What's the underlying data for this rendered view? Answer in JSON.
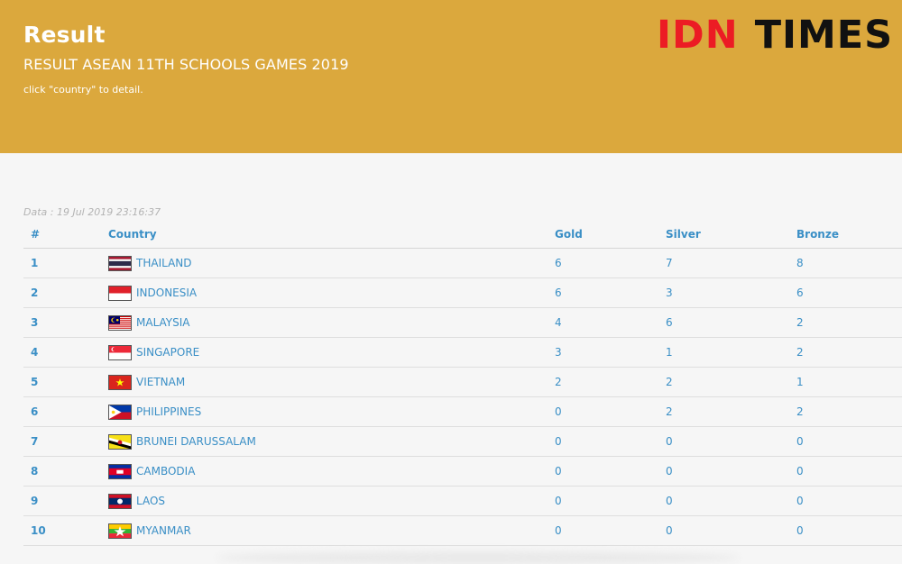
{
  "header": {
    "title": "Result",
    "subtitle": "RESULT ASEAN 11TH SCHOOLS GAMES 2019",
    "hint": "click \"country\" to detail.",
    "logo_left": "IDN",
    "logo_right": "TIMES",
    "brand_color": "#dba83d",
    "logo_accent": "#ec1c24"
  },
  "table": {
    "timestamp": "Data : 19 Jul 2019 23:16:37",
    "columns": {
      "rank": "#",
      "country": "Country",
      "gold": "Gold",
      "silver": "Silver",
      "bronze": "Bronze"
    },
    "link_color": "#3a8fc6",
    "rows": [
      {
        "rank": "1",
        "country": "THAILAND",
        "flag": "thailand-flag-icon",
        "gold": "6",
        "silver": "7",
        "bronze": "8"
      },
      {
        "rank": "2",
        "country": "INDONESIA",
        "flag": "indonesia-flag-icon",
        "gold": "6",
        "silver": "3",
        "bronze": "6"
      },
      {
        "rank": "3",
        "country": "MALAYSIA",
        "flag": "malaysia-flag-icon",
        "gold": "4",
        "silver": "6",
        "bronze": "2"
      },
      {
        "rank": "4",
        "country": "SINGAPORE",
        "flag": "singapore-flag-icon",
        "gold": "3",
        "silver": "1",
        "bronze": "2"
      },
      {
        "rank": "5",
        "country": "VIETNAM",
        "flag": "vietnam-flag-icon",
        "gold": "2",
        "silver": "2",
        "bronze": "1"
      },
      {
        "rank": "6",
        "country": "PHILIPPINES",
        "flag": "philippines-flag-icon",
        "gold": "0",
        "silver": "2",
        "bronze": "2"
      },
      {
        "rank": "7",
        "country": "BRUNEI DARUSSALAM",
        "flag": "brunei-flag-icon",
        "gold": "0",
        "silver": "0",
        "bronze": "0"
      },
      {
        "rank": "8",
        "country": "CAMBODIA",
        "flag": "cambodia-flag-icon",
        "gold": "0",
        "silver": "0",
        "bronze": "0"
      },
      {
        "rank": "9",
        "country": "LAOS",
        "flag": "laos-flag-icon",
        "gold": "0",
        "silver": "0",
        "bronze": "0"
      },
      {
        "rank": "10",
        "country": "MYANMAR",
        "flag": "myanmar-flag-icon",
        "gold": "0",
        "silver": "0",
        "bronze": "0"
      }
    ]
  }
}
